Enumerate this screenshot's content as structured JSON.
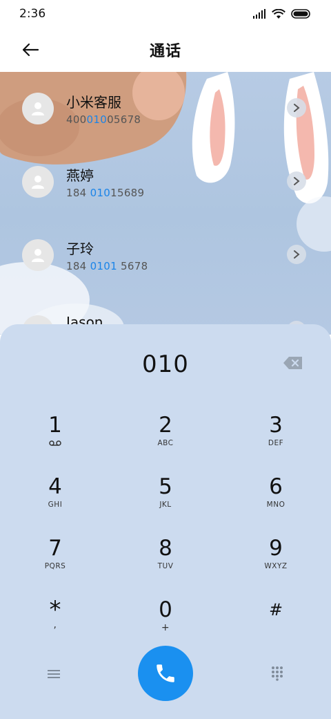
{
  "status_bar": {
    "time": "2:36"
  },
  "header": {
    "title": "通话",
    "back_icon": "arrow-left-icon"
  },
  "contacts": [
    {
      "name": "小米客服",
      "number_pre": "400",
      "number_match": "010",
      "number_post": "05678"
    },
    {
      "name": "燕婷",
      "number_pre": "184 ",
      "number_match": "010",
      "number_post": "15689"
    },
    {
      "name": "子玲",
      "number_pre": "184 ",
      "number_match": "0101",
      "number_post": " 5678"
    },
    {
      "name": "Jason",
      "number_pre": "",
      "number_match": "",
      "number_post": ""
    }
  ],
  "dialpad": {
    "display": "010",
    "keys": [
      {
        "digit": "1",
        "letters": "",
        "sub_icon": "voicemail-icon"
      },
      {
        "digit": "2",
        "letters": "ABC"
      },
      {
        "digit": "3",
        "letters": "DEF"
      },
      {
        "digit": "4",
        "letters": "GHI"
      },
      {
        "digit": "5",
        "letters": "JKL"
      },
      {
        "digit": "6",
        "letters": "MNO"
      },
      {
        "digit": "7",
        "letters": "PQRS"
      },
      {
        "digit": "8",
        "letters": "TUV"
      },
      {
        "digit": "9",
        "letters": "WXYZ"
      },
      {
        "digit": "*",
        "letters": ","
      },
      {
        "digit": "0",
        "letters": "+"
      },
      {
        "digit": "#",
        "letters": ""
      }
    ]
  },
  "colors": {
    "accent": "#1a90f0",
    "highlight": "#1a84e8",
    "dialpad_bg": "#ccdbef"
  }
}
